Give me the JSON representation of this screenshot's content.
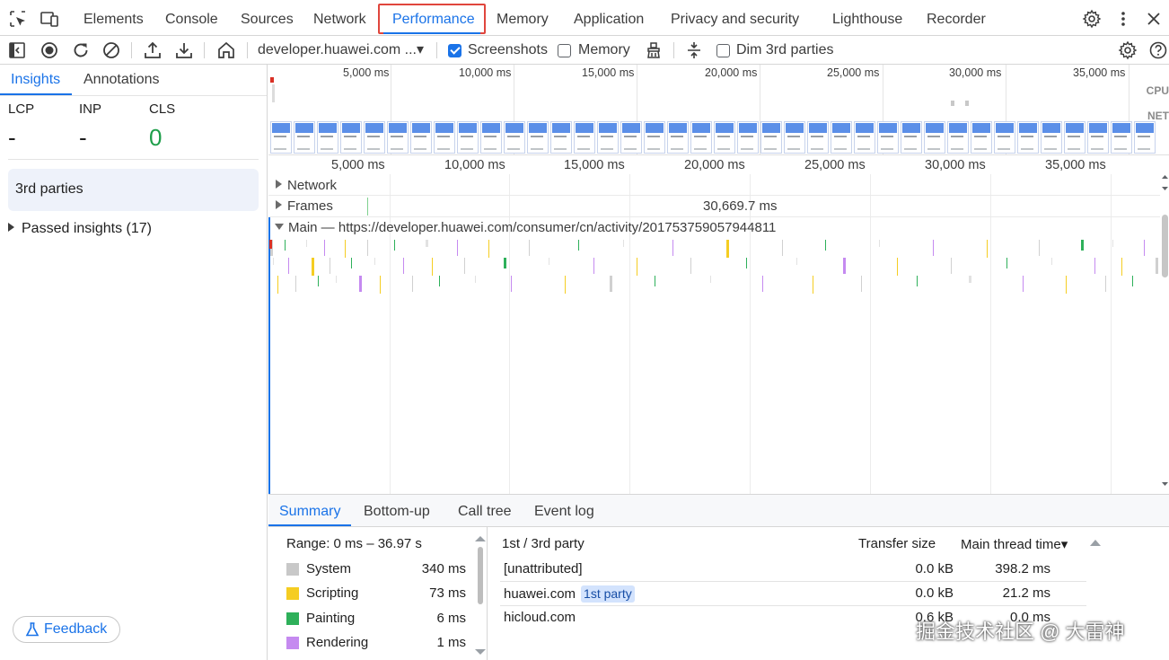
{
  "topbar": {
    "tabs": [
      "Elements",
      "Console",
      "Sources",
      "Network",
      "Performance",
      "Memory",
      "Application",
      "Privacy and security",
      "Lighthouse",
      "Recorder"
    ],
    "active_tab": "Performance",
    "icons": [
      "inspect-element-icon",
      "device-toolbar-icon",
      "settings-icon",
      "more-options-icon",
      "close-icon"
    ]
  },
  "toolbar": {
    "target": "developer.huawei.com ...▾",
    "screenshots_label": "Screenshots",
    "screenshots_checked": true,
    "memory_label": "Memory",
    "memory_checked": false,
    "dim_label": "Dim 3rd parties",
    "dim_checked": false,
    "icons": [
      "toggle-sidebar-icon",
      "record-icon",
      "reload-record-icon",
      "clear-icon",
      "upload-icon",
      "download-icon",
      "home-icon",
      "garbage-collect-icon",
      "track-config-icon",
      "capture-settings-icon",
      "help-icon"
    ]
  },
  "left": {
    "tabs": [
      "Insights",
      "Annotations"
    ],
    "metrics": [
      {
        "label": "LCP",
        "value": "-"
      },
      {
        "label": "INP",
        "value": "-"
      },
      {
        "label": "CLS",
        "value": "0"
      }
    ],
    "card": "3rd parties",
    "passed": "Passed insights (17)",
    "feedback": "Feedback"
  },
  "overview": {
    "ticks": [
      "5,000 ms",
      "10,000 ms",
      "15,000 ms",
      "20,000 ms",
      "25,000 ms",
      "30,000 ms",
      "35,000 ms"
    ],
    "cpu_label": "CPU",
    "net_label": "NET"
  },
  "ruler": {
    "ticks": [
      "5,000 ms",
      "10,000 ms",
      "15,000 ms",
      "20,000 ms",
      "25,000 ms",
      "30,000 ms",
      "35,000 ms"
    ]
  },
  "tracks": {
    "network": "Network",
    "frames": "Frames",
    "frames_duration": "30,669.7 ms",
    "main": "Main — https://developer.huawei.com/consumer/cn/activity/201753759057944811"
  },
  "bottom": {
    "tabs": [
      "Summary",
      "Bottom-up",
      "Call tree",
      "Event log"
    ],
    "range": "Range: 0 ms – 36.97 s",
    "categories": [
      {
        "name": "System",
        "value": "340 ms",
        "color": "#c8c8c8"
      },
      {
        "name": "Scripting",
        "value": "73 ms",
        "color": "#f5cd22"
      },
      {
        "name": "Painting",
        "value": "6 ms",
        "color": "#2eb05a"
      },
      {
        "name": "Rendering",
        "value": "1 ms",
        "color": "#c58af0"
      }
    ],
    "table": {
      "headers": [
        "1st / 3rd party",
        "Transfer size",
        "Main thread time▾"
      ],
      "rows": [
        {
          "name": "[unattributed]",
          "badge": "",
          "size": "0.0 kB",
          "time": "398.2 ms"
        },
        {
          "name": "huawei.com",
          "badge": "1st party",
          "size": "0.0 kB",
          "time": "21.2 ms"
        },
        {
          "name": "hicloud.com",
          "badge": "",
          "size": "0.6 kB",
          "time": "0.0 ms"
        }
      ]
    }
  },
  "watermark": "掘金技术社区 @ 大雷神"
}
